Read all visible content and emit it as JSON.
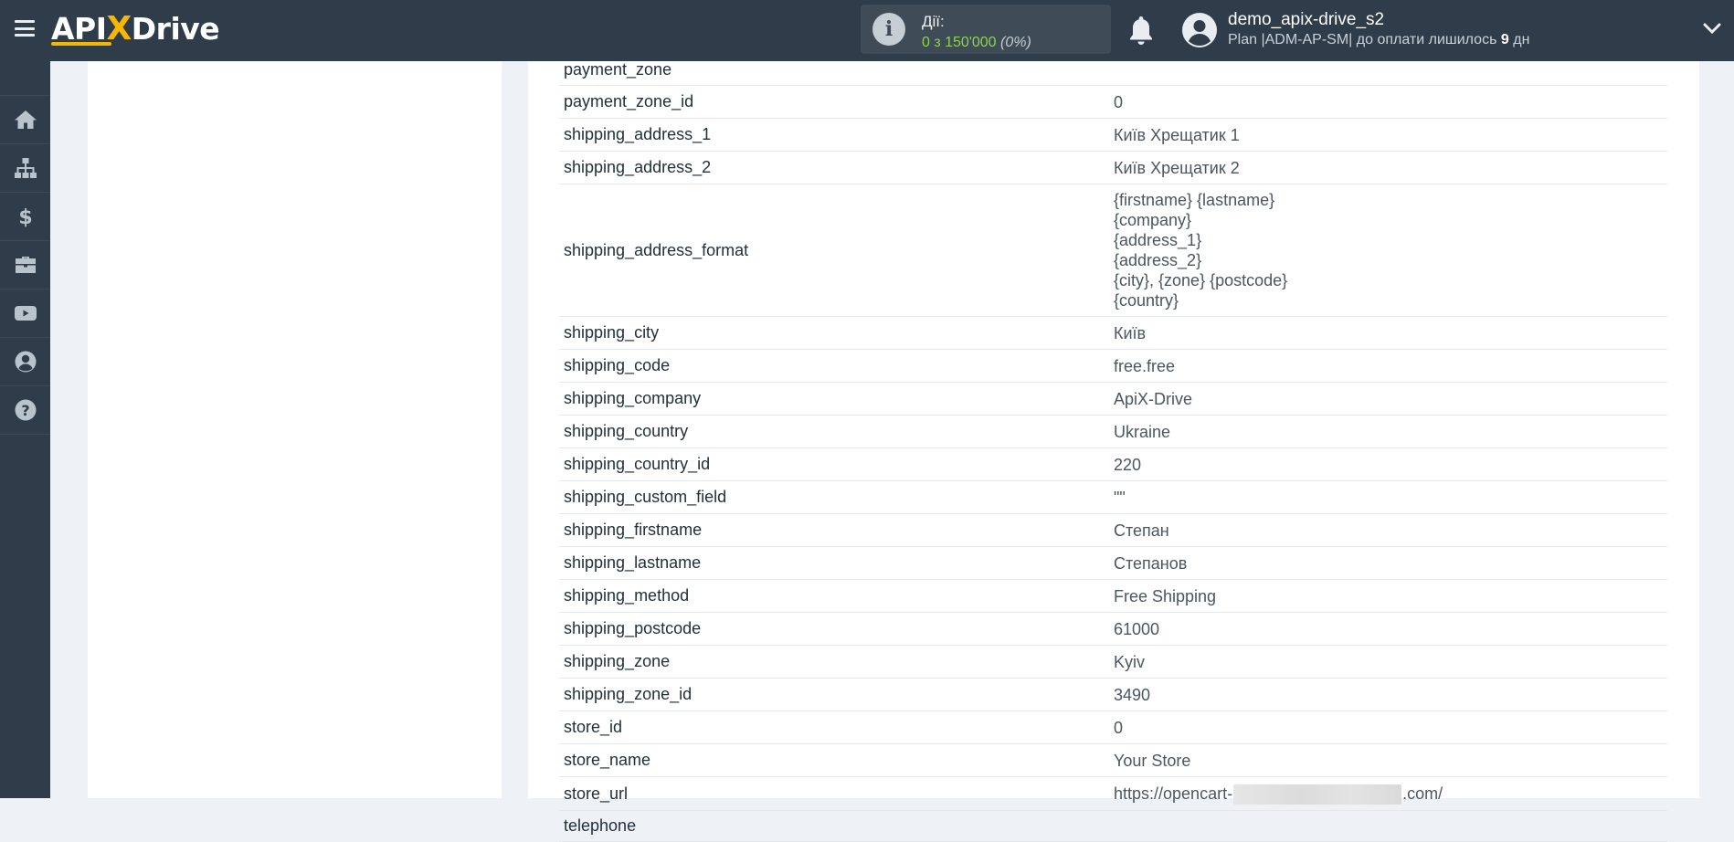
{
  "header": {
    "logo_prefix": "API",
    "logo_x": "X",
    "logo_suffix": "Drive",
    "actions_label": "Дії:",
    "actions_value": "0 з 150'000",
    "actions_percent": "(0%)",
    "user_name": "demo_apix-drive_s2",
    "plan_text": "Plan |ADM-AP-SM| до оплати лишилось",
    "plan_days": "9",
    "plan_days_unit": "дн"
  },
  "sidebar": {
    "items": [
      {
        "icon": "home-icon"
      },
      {
        "icon": "sitemap-icon"
      },
      {
        "icon": "dollar-icon"
      },
      {
        "icon": "briefcase-icon"
      },
      {
        "icon": "youtube-icon"
      },
      {
        "icon": "user-circle-icon"
      },
      {
        "icon": "help-icon"
      }
    ]
  },
  "table": {
    "rows": [
      {
        "key": "payment_zone",
        "value": ""
      },
      {
        "key": "payment_zone_id",
        "value": "0"
      },
      {
        "key": "shipping_address_1",
        "value": "Київ Хрещатик 1"
      },
      {
        "key": "shipping_address_2",
        "value": "Київ Хрещатик 2"
      },
      {
        "key": "shipping_address_format",
        "value": "{firstname} {lastname}\n{company}\n{address_1}\n{address_2}\n{city}, {zone} {postcode}\n{country}"
      },
      {
        "key": "shipping_city",
        "value": "Київ"
      },
      {
        "key": "shipping_code",
        "value": "free.free"
      },
      {
        "key": "shipping_company",
        "value": "ApiX-Drive"
      },
      {
        "key": "shipping_country",
        "value": "Ukraine"
      },
      {
        "key": "shipping_country_id",
        "value": "220"
      },
      {
        "key": "shipping_custom_field",
        "value": "\"\""
      },
      {
        "key": "shipping_firstname",
        "value": "Степан"
      },
      {
        "key": "shipping_lastname",
        "value": "Степанов"
      },
      {
        "key": "shipping_method",
        "value": "Free Shipping"
      },
      {
        "key": "shipping_postcode",
        "value": "61000"
      },
      {
        "key": "shipping_zone",
        "value": "Kyiv"
      },
      {
        "key": "shipping_zone_id",
        "value": "3490"
      },
      {
        "key": "store_id",
        "value": "0"
      },
      {
        "key": "store_name",
        "value": "Your Store"
      },
      {
        "key": "store_url",
        "value_prefix": "https://opencart-",
        "value_suffix": ".com/"
      },
      {
        "key": "telephone",
        "value": ""
      }
    ]
  },
  "colors": {
    "topbar": "#2f3d4a",
    "accent": "#f5b700",
    "actions_green": "#8fd14f",
    "background": "#eef1f5"
  }
}
